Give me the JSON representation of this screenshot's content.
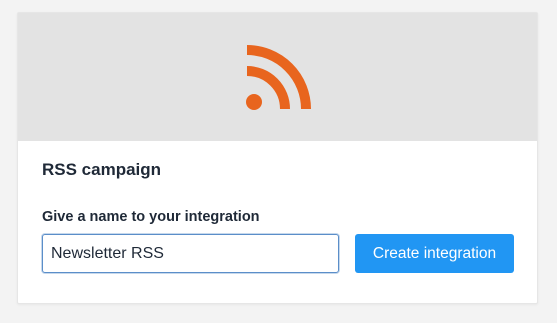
{
  "card": {
    "icon": "rss-icon",
    "icon_color": "#e8651e",
    "banner_color": "#e3e3e3",
    "title": "RSS campaign"
  },
  "form": {
    "label": "Give a name to your integration",
    "name_value": "Newsletter RSS",
    "submit_label": "Create integration",
    "submit_color": "#2196f3"
  }
}
